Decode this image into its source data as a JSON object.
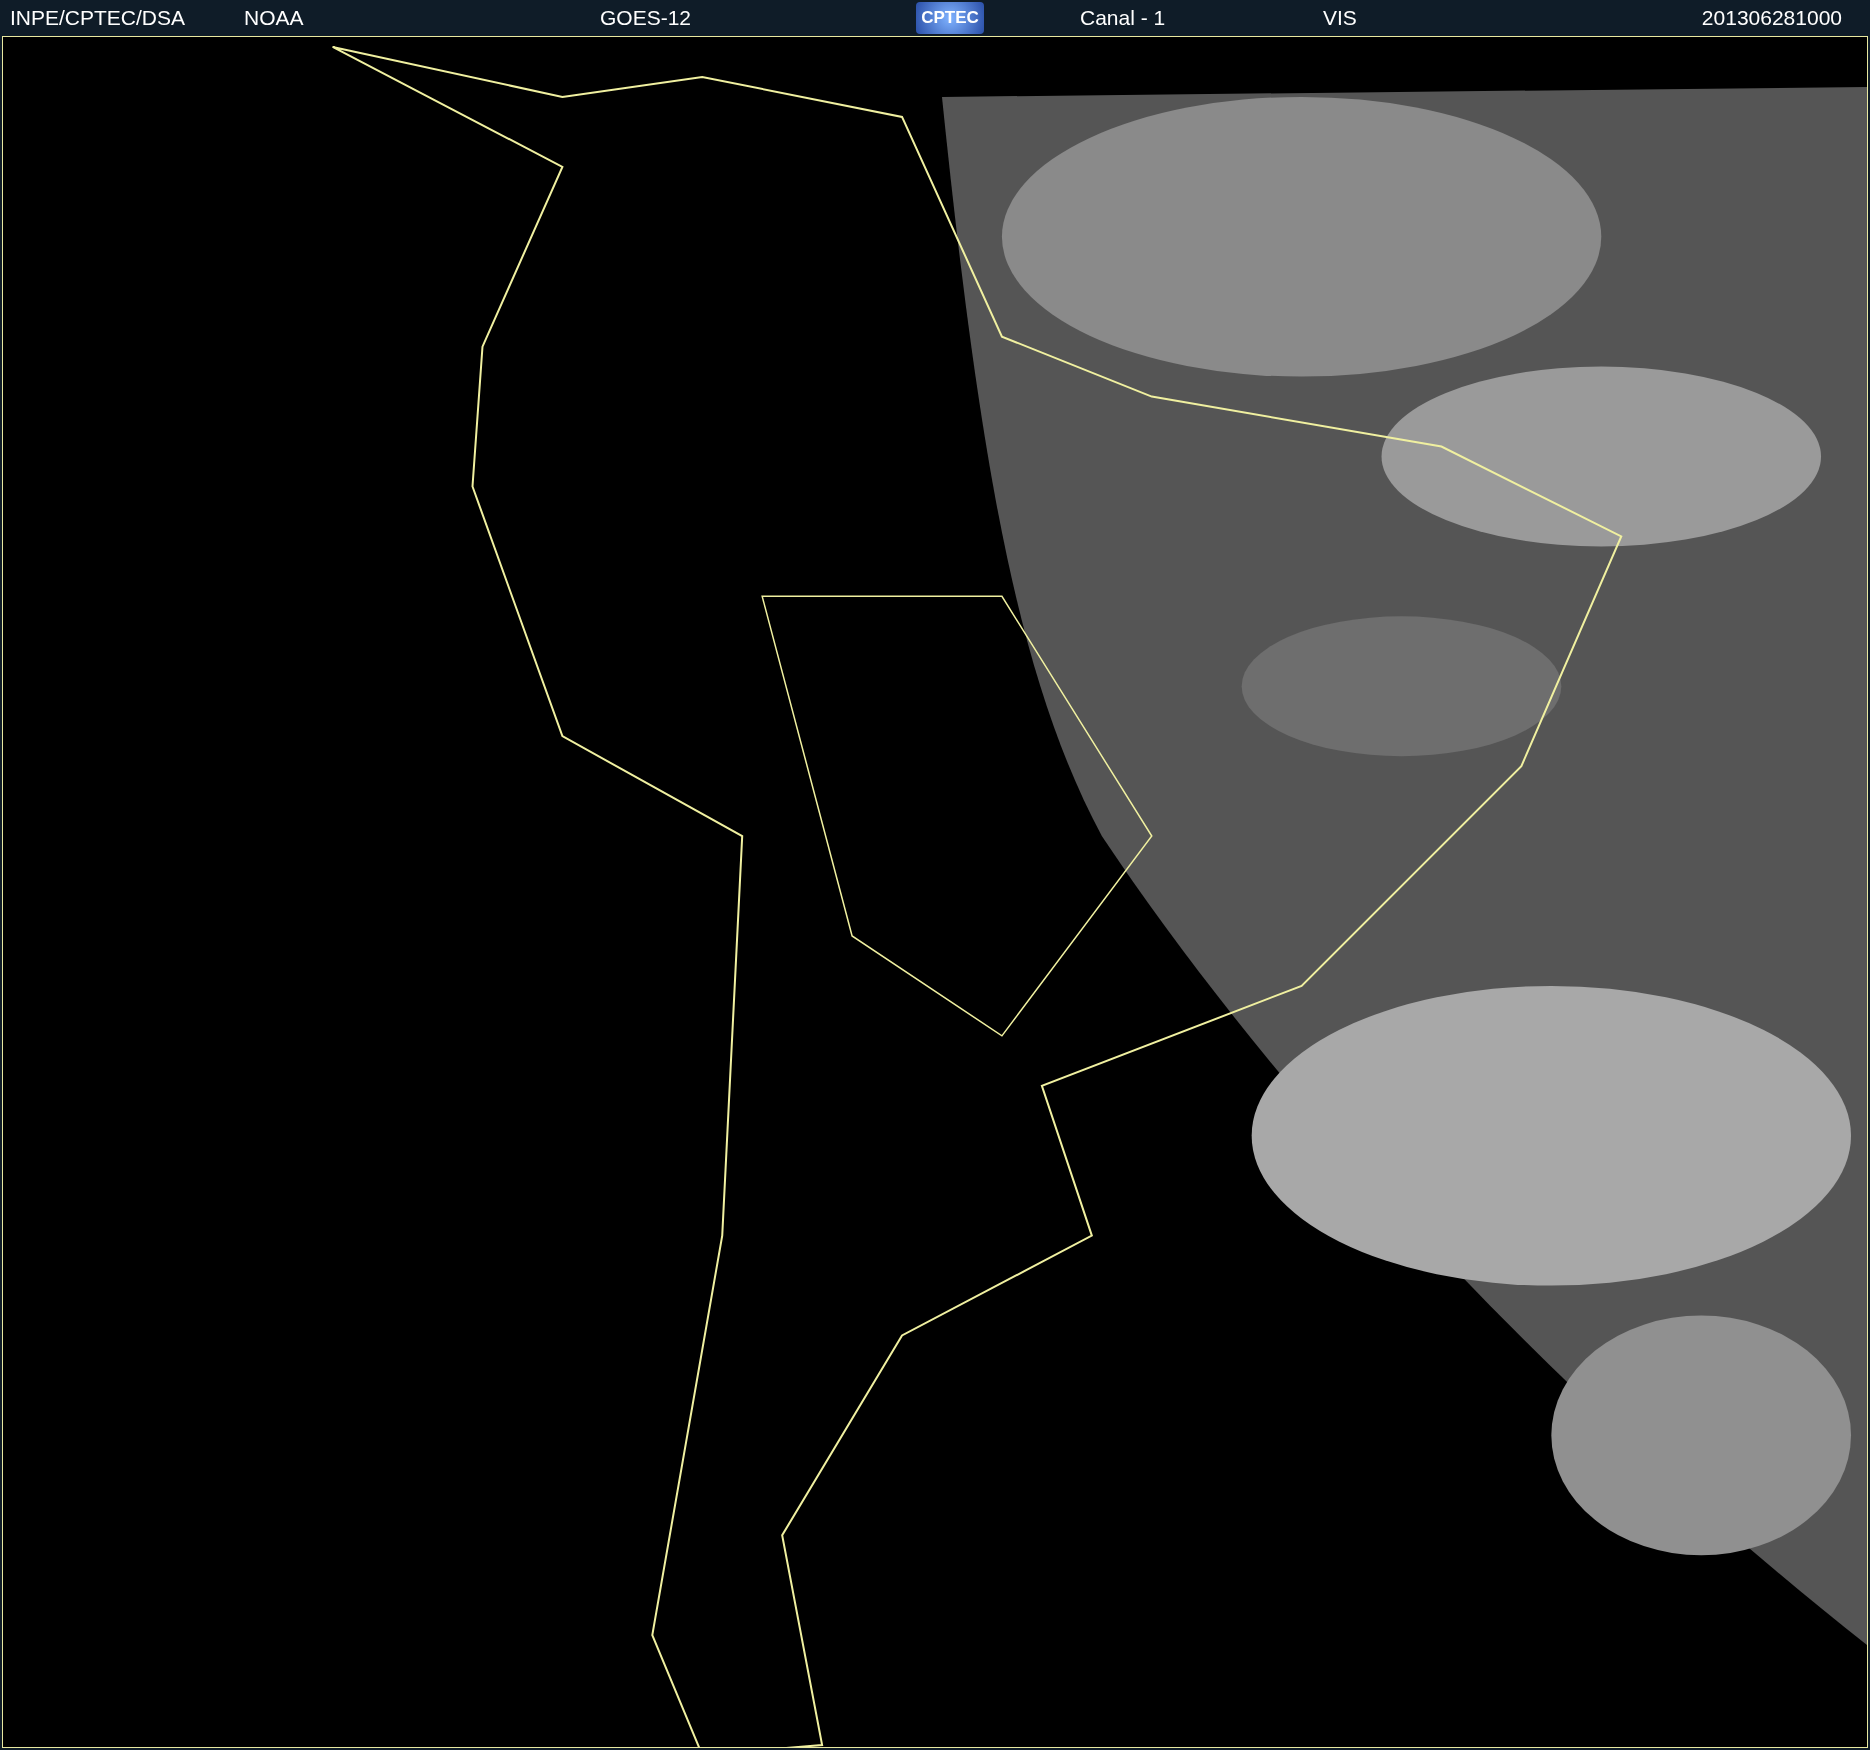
{
  "header": {
    "source": "INPE/CPTEC/DSA",
    "agency": "NOAA",
    "satellite": "GOES-12",
    "logo": "CPTEC",
    "channel": "Canal - 1",
    "band": "VIS",
    "timestamp": "201306281000"
  }
}
